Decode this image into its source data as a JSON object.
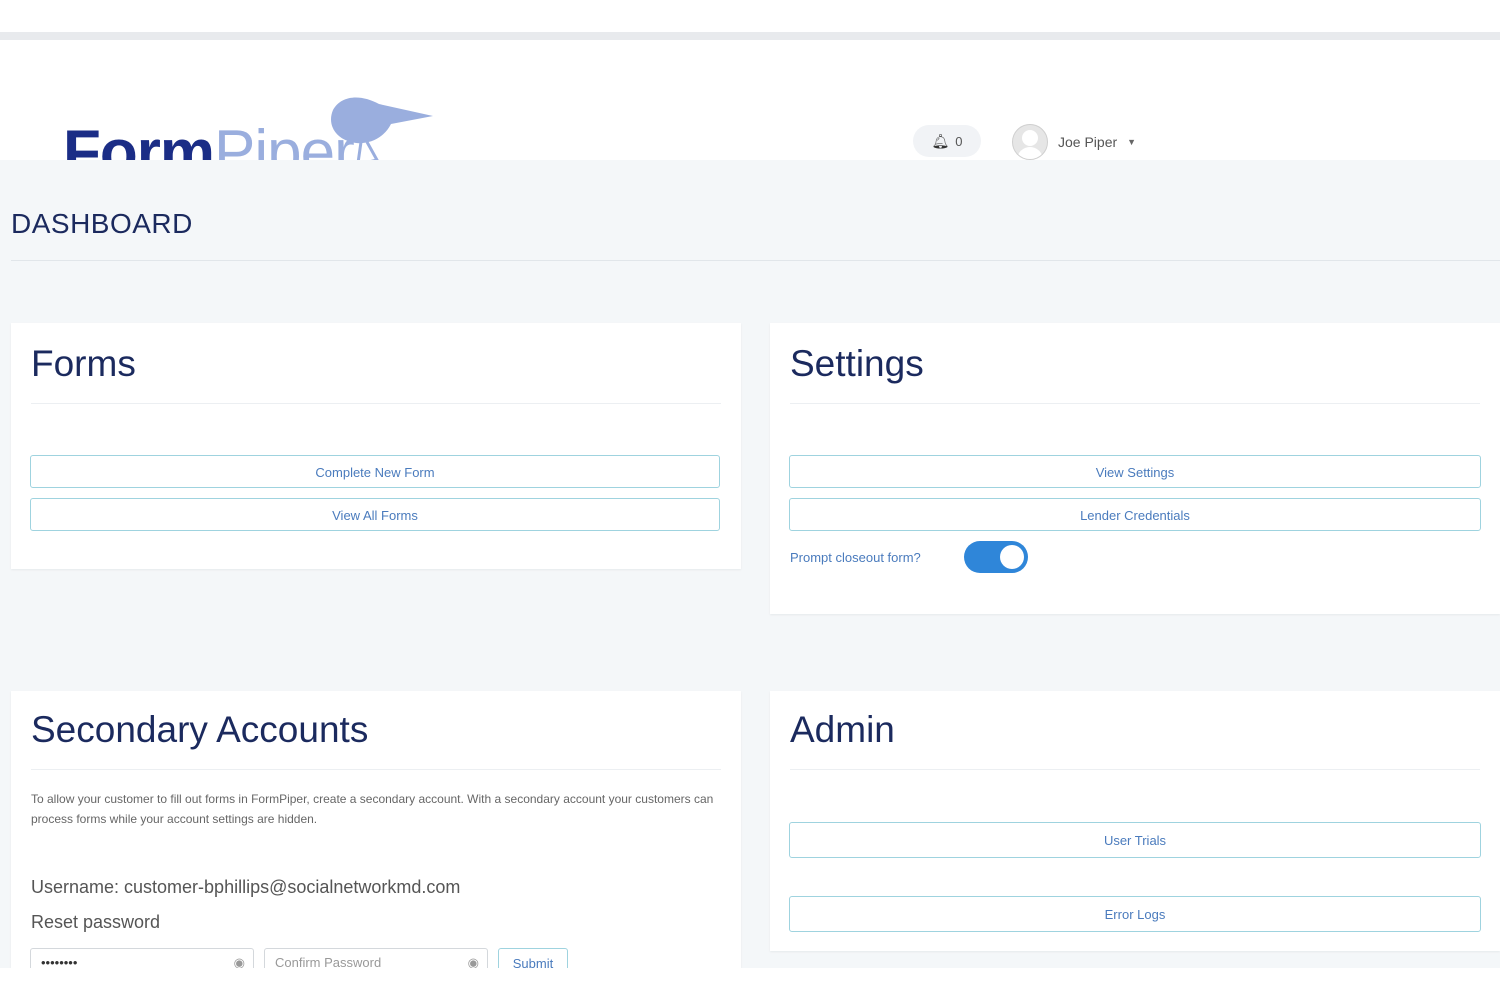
{
  "brand": {
    "logo_bold": "Form",
    "logo_light": "Piper"
  },
  "header": {
    "notification_count": "0",
    "user_name": "Joe Piper"
  },
  "dashboard": {
    "title": "DASHBOARD"
  },
  "forms_panel": {
    "title": "Forms",
    "buttons": [
      "Complete New Form",
      "View All Forms"
    ]
  },
  "settings_panel": {
    "title": "Settings",
    "buttons": [
      "View Settings",
      "Lender Credentials"
    ],
    "toggle_label": "Prompt closeout form?",
    "toggle_on": true
  },
  "secondary_panel": {
    "title": "Secondary Accounts",
    "description": "To allow your customer to fill out forms in FormPiper, create a secondary account. With a secondary account your customers can process forms while your account settings are hidden.",
    "username_line": "Username: customer-bphillips@socialnetworkmd.com",
    "reset_label": "Reset password",
    "password_value": "••••••••",
    "confirm_placeholder": "Confirm Password",
    "submit_label": "Submit"
  },
  "admin_panel": {
    "title": "Admin",
    "buttons": [
      "User Trials",
      "Error Logs"
    ]
  },
  "colors": {
    "brand_dark": "#1b2d86",
    "brand_light": "#9aaede",
    "accent": "#2f86d9",
    "button_border": "#9fd3df"
  }
}
